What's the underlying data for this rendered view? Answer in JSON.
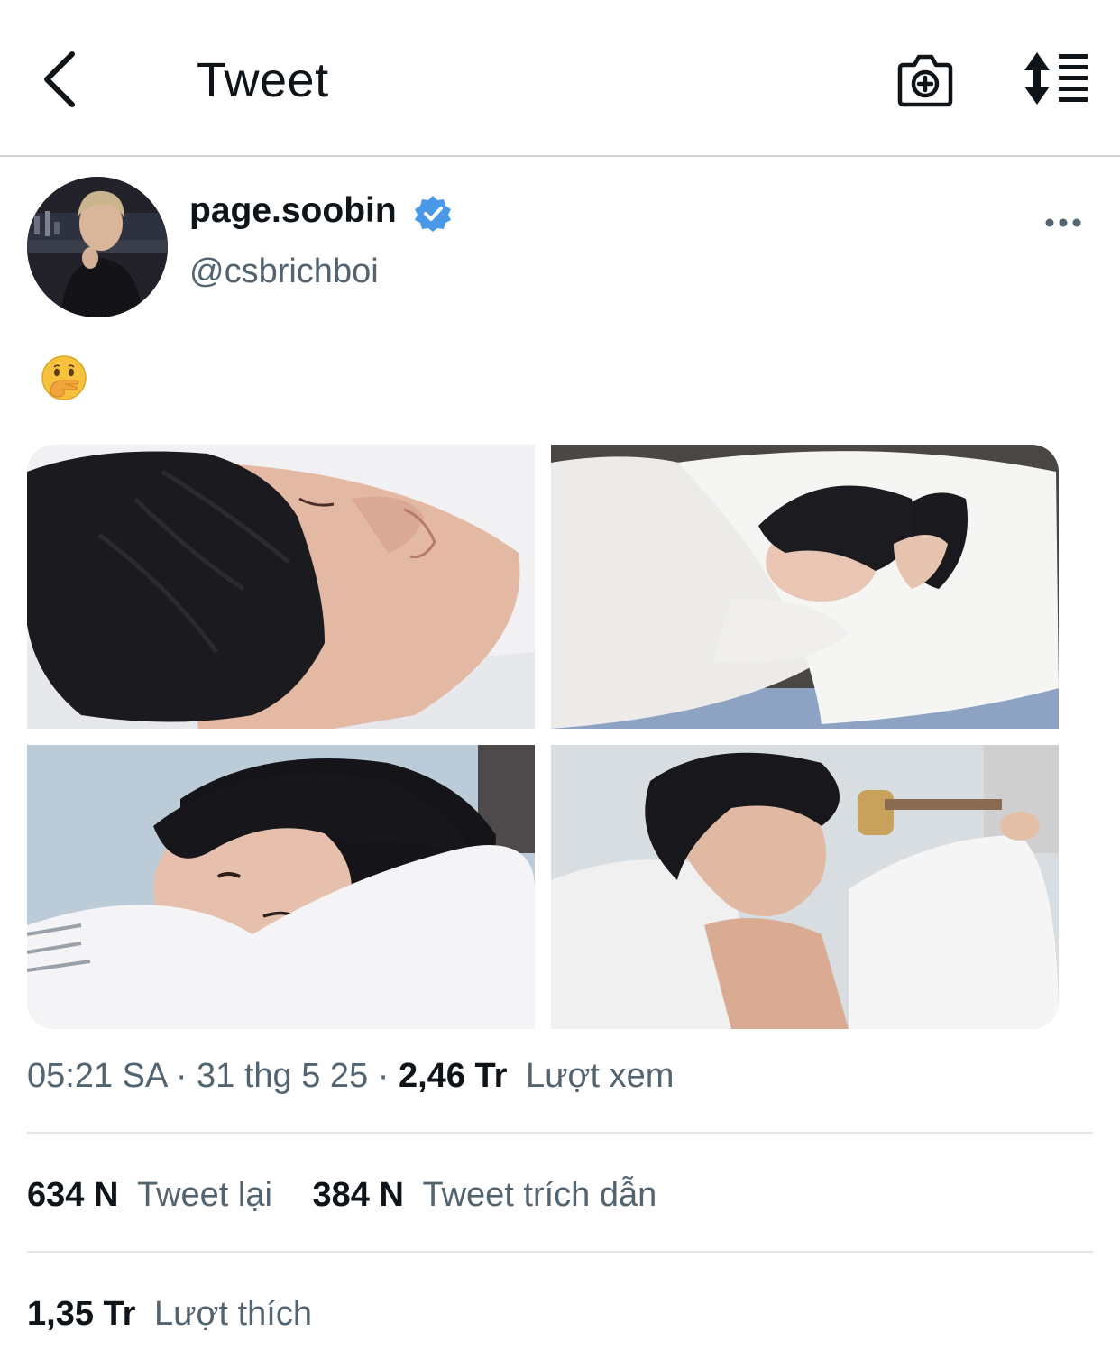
{
  "header": {
    "title": "Tweet",
    "back_icon": "chevron-left-icon",
    "camera_icon": "camera-plus-icon",
    "sort_icon": "sort-lines-icon"
  },
  "author": {
    "display_name": "page.soobin",
    "handle": "@csbrichboi",
    "verified": true,
    "badge_color": "#4a99e9"
  },
  "tweet": {
    "text_emoji": "face-with-hand-over-mouth",
    "media_count": 4
  },
  "meta": {
    "time": "05:21 SA",
    "separator": "·",
    "date": "31 thg 5 25",
    "views_count": "2,46 Tr",
    "views_label": "Lượt xem"
  },
  "stats": {
    "retweets_count": "634 N",
    "retweets_label": "Tweet lại",
    "quotes_count": "384 N",
    "quotes_label": "Tweet trích dẫn",
    "likes_count": "1,35 Tr",
    "likes_label": "Lượt thích"
  },
  "colors": {
    "text_primary": "#0f1419",
    "text_secondary": "#536471",
    "divider": "#e1e4e8"
  }
}
